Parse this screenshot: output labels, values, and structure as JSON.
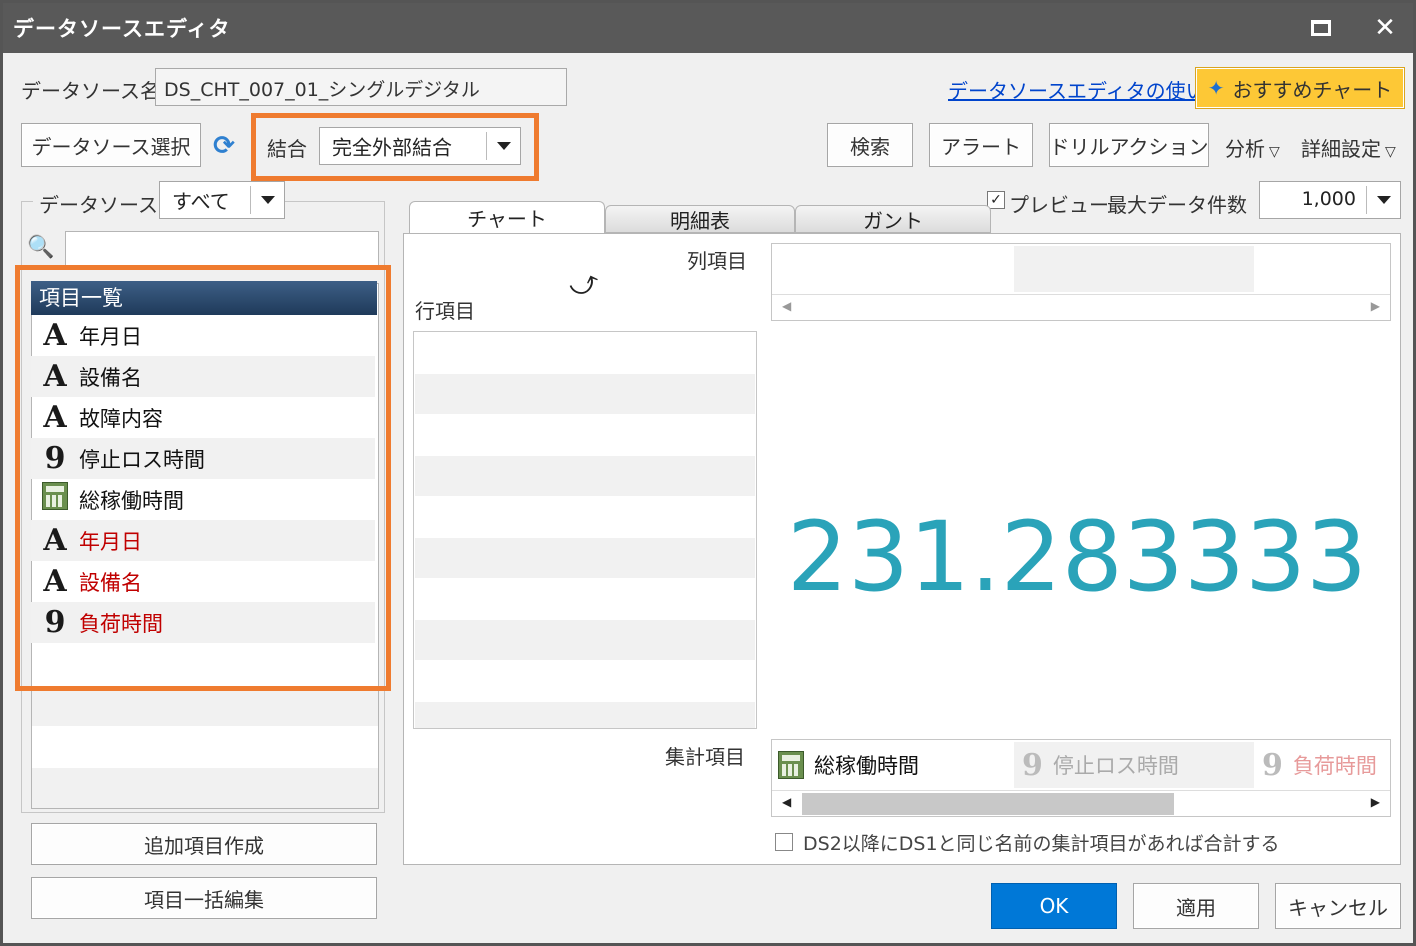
{
  "window": {
    "title": "データソースエディタ"
  },
  "header": {
    "ds_name_label": "データソース名",
    "ds_name_value": "DS_CHT_007_01_シングルデジタル",
    "help_link": "データソースエディタの使い方",
    "recommend_button": "おすすめチャート"
  },
  "toolbar": {
    "ds_select_button": "データソース選択",
    "join_label": "結合",
    "join_value": "完全外部結合",
    "search_button": "検索",
    "alert_button": "アラート",
    "drill_button": "ドリルアクション",
    "analysis_menu": "分析",
    "detail_menu": "詳細設定"
  },
  "left": {
    "datasource_label": "データソース",
    "datasource_filter": "すべて",
    "list_header": "項目一覧",
    "items": [
      {
        "icon": "A",
        "type": "text",
        "label": "年月日",
        "red": false
      },
      {
        "icon": "A",
        "type": "text",
        "label": "設備名",
        "red": false
      },
      {
        "icon": "A",
        "type": "text",
        "label": "故障内容",
        "red": false
      },
      {
        "icon": "9",
        "type": "number",
        "label": "停止ロス時間",
        "red": false
      },
      {
        "icon": "calc",
        "type": "calculated",
        "label": "総稼働時間",
        "red": false
      },
      {
        "icon": "A",
        "type": "text",
        "label": "年月日",
        "red": true
      },
      {
        "icon": "A",
        "type": "text",
        "label": "設備名",
        "red": true
      },
      {
        "icon": "9",
        "type": "number",
        "label": "負荷時間",
        "red": true
      }
    ],
    "add_item_button": "追加項目作成",
    "bulk_edit_button": "項目一括編集"
  },
  "preview": {
    "checkbox_label": "プレビュー",
    "checked": true,
    "max_rows_label": "最大データ件数",
    "max_rows_value": "1,000"
  },
  "tabs": [
    {
      "label": "チャート",
      "active": true
    },
    {
      "label": "明細表",
      "active": false
    },
    {
      "label": "ガント",
      "active": false
    }
  ],
  "chart_area": {
    "column_items_label": "列項目",
    "row_items_label": "行項目",
    "summary_items_label": "集計項目",
    "big_value": "231.283333",
    "big_value_color": "#2aa3b9",
    "summary_items": [
      {
        "icon": "calc",
        "label": "総稼働時間",
        "style": "normal"
      },
      {
        "icon": "9",
        "label": "停止ロス時間",
        "style": "dim"
      },
      {
        "icon": "9",
        "label": "負荷時間",
        "style": "dim-red"
      }
    ],
    "sum_checkbox_label": "DS2以降にDS1と同じ名前の集計項目があれば合計する"
  },
  "footer": {
    "ok_button": "OK",
    "apply_button": "適用",
    "cancel_button": "キャンセル"
  },
  "colors": {
    "titlebar": "#595959",
    "highlight_border": "#ef7b2f",
    "ok_button": "#0078d7",
    "recommend_button": "#fdc836",
    "list_header": "#2b4a6f"
  }
}
